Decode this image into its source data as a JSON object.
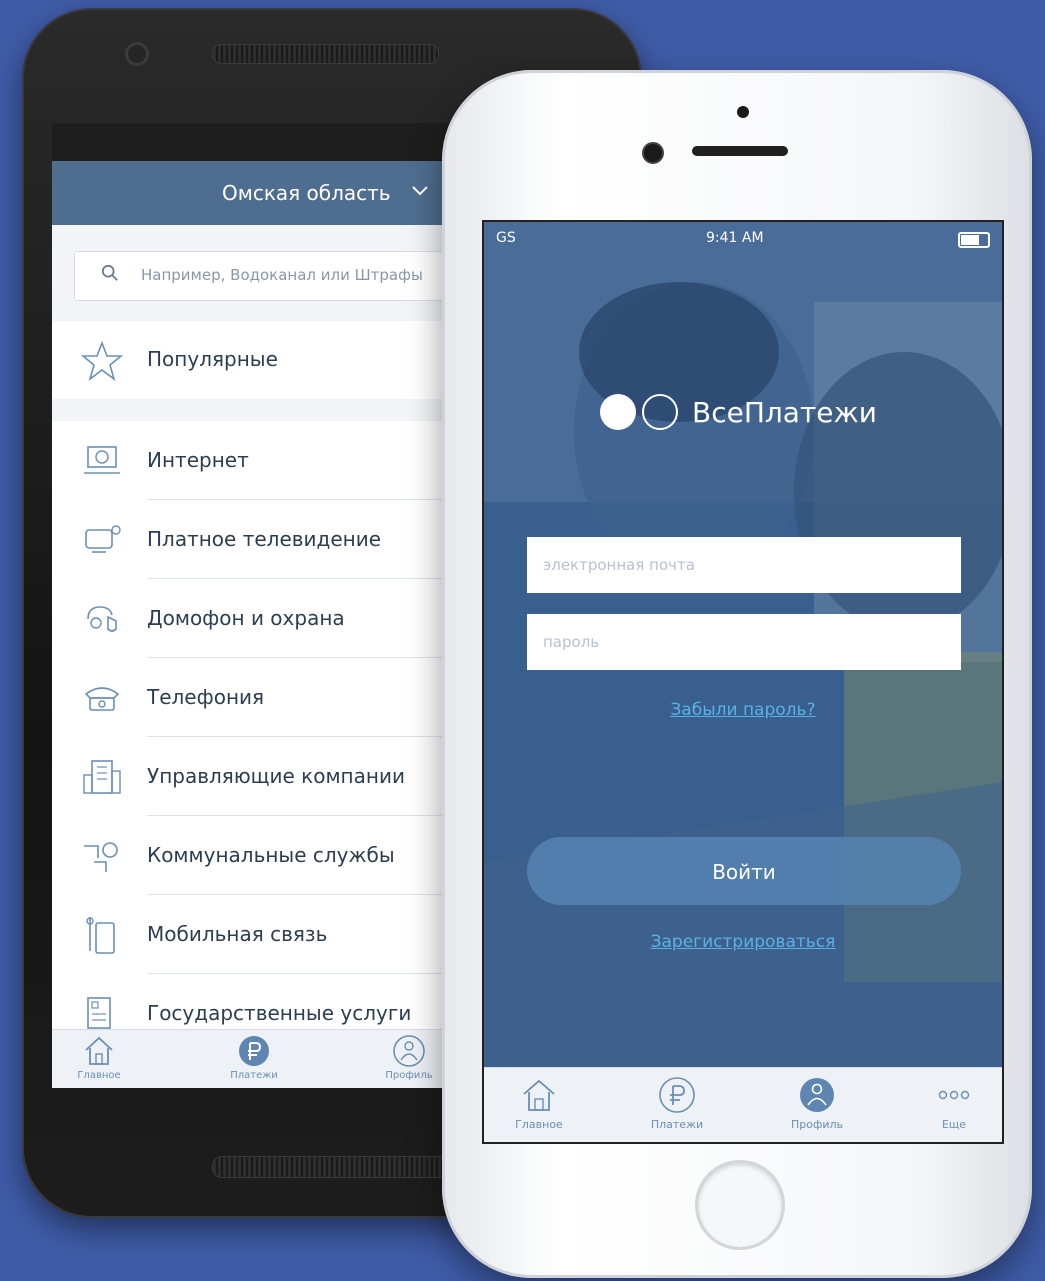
{
  "android": {
    "region": "Омская область",
    "search_placeholder": "Например, Водоканал или Штрафы",
    "popular": "Популярные",
    "categories": [
      {
        "label": "Интернет",
        "icon": "internet-icon"
      },
      {
        "label": "Платное телевидение",
        "icon": "tv-icon"
      },
      {
        "label": "Домофон и охрана",
        "icon": "intercom-icon"
      },
      {
        "label": "Телефония",
        "icon": "phone-icon"
      },
      {
        "label": "Управляющие компании",
        "icon": "building-icon"
      },
      {
        "label": "Коммунальные службы",
        "icon": "utilities-icon"
      },
      {
        "label": "Мобильная связь",
        "icon": "mobile-icon"
      },
      {
        "label": "Государственные услуги",
        "icon": "government-icon"
      }
    ],
    "tabs": [
      {
        "label": "Главное",
        "icon": "home-icon"
      },
      {
        "label": "Платежи",
        "icon": "ruble-icon"
      },
      {
        "label": "Профиль",
        "icon": "profile-icon"
      }
    ],
    "active_tab": "Платежи"
  },
  "iphone": {
    "status": {
      "carrier": "GS",
      "time": "9:41 AM"
    },
    "brand": "ВсеПлатежи",
    "email_placeholder": "электронная почта",
    "password_placeholder": "пароль",
    "forgot_link": "Забыли пароль?",
    "login_button": "Войти",
    "register_link": "Зарегистрироваться",
    "tabs": [
      {
        "label": "Главное",
        "icon": "home-icon"
      },
      {
        "label": "Платежи",
        "icon": "ruble-icon"
      },
      {
        "label": "Профиль",
        "icon": "profile-icon"
      },
      {
        "label": "Еще",
        "icon": "more-icon"
      }
    ],
    "active_tab": "Профиль"
  },
  "colors": {
    "background": "#3f5ca8",
    "header": "#4f6e8f",
    "link": "#5ab1e6",
    "icon_accent": "#6a8fb5"
  }
}
